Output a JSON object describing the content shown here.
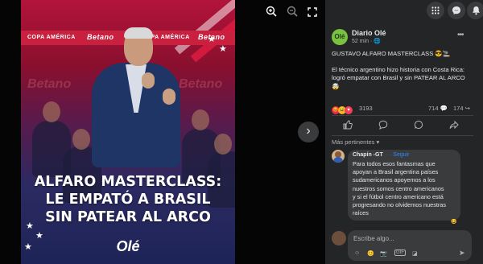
{
  "viewer": {
    "headline_lines": [
      "ALFARO MASTERCLASS:",
      "LE EMPATÓ A BRASIL",
      "SIN PATEAR AL ARCO"
    ],
    "brand_logo": "Olé",
    "banner_texts": [
      "COPA AMÉRICA",
      "Betano",
      "COPA AMÉRICA",
      "Betano"
    ],
    "tools": [
      "zoom-in-icon",
      "zoom-out-icon",
      "fullscreen-icon"
    ],
    "next_glyph": "›"
  },
  "topbar": {
    "icons": [
      "apps-grid-icon",
      "messenger-icon",
      "notifications-bell-icon"
    ]
  },
  "post": {
    "page_name": "Diario Olé",
    "avatar_text": "Olé",
    "time": "52 min",
    "title": "GUSTAVO ALFARO MASTERCLASS 😎🚬",
    "body_lines": [
      "El técnico argentino hizo historia con Costa Rica:",
      "logró empatar con Brasil y sin PATEAR AL ARCO",
      "🤯"
    ],
    "reaction_count": "3193",
    "comment_count": "714",
    "share_count": "174",
    "actions": [
      "like-icon",
      "comment-icon",
      "whatsapp-icon",
      "share-icon"
    ]
  },
  "comments": {
    "sort_label": "Más pertinentes",
    "items": [
      {
        "author": "Chapín -GT",
        "tag": "· Seguir",
        "lines": [
          "Para todos esos fantasmas que",
          "apoyan a Brasil argentina países",
          "sudamericanos apoyemos a los",
          "nuestros somos centro americanos",
          "y si el fútbol centro americano está",
          "progresando no olvidemos nuestras",
          "raíces"
        ]
      }
    ],
    "composer_placeholder": "Escribe algo..."
  },
  "colors": {
    "panel_bg": "#242526",
    "text": "#e4e6eb",
    "muted": "#b0b3b8",
    "link": "#2d88ff",
    "ole_green": "#7ac142"
  }
}
